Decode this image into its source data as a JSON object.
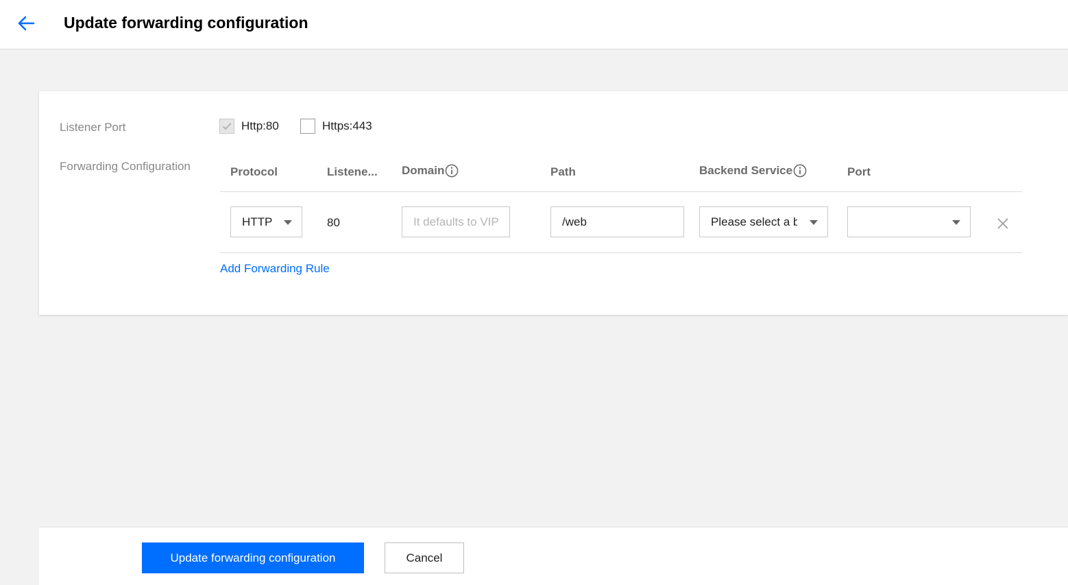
{
  "header": {
    "title": "Update forwarding configuration",
    "back_icon": "arrow-left-icon",
    "accent_color": "#006eff"
  },
  "form": {
    "listener_port_label": "Listener Port",
    "listener_ports": [
      {
        "label": "Http:80",
        "checked": true,
        "disabled": true
      },
      {
        "label": "Https:443",
        "checked": false,
        "disabled": false
      }
    ],
    "forwarding_config_label": "Forwarding Configuration",
    "columns": {
      "protocol": "Protocol",
      "listener": "Listene...",
      "domain": "Domain",
      "path": "Path",
      "backend_service": "Backend Service",
      "port": "Port"
    },
    "rules": [
      {
        "protocol": "HTTP",
        "listener_port": "80",
        "domain_placeholder": "It defaults to VIP",
        "path": "/web",
        "backend_service_placeholder": "Please select a b",
        "port": ""
      }
    ],
    "add_rule_label": "Add Forwarding Rule"
  },
  "footer": {
    "submit_label": "Update forwarding configuration",
    "cancel_label": "Cancel"
  }
}
